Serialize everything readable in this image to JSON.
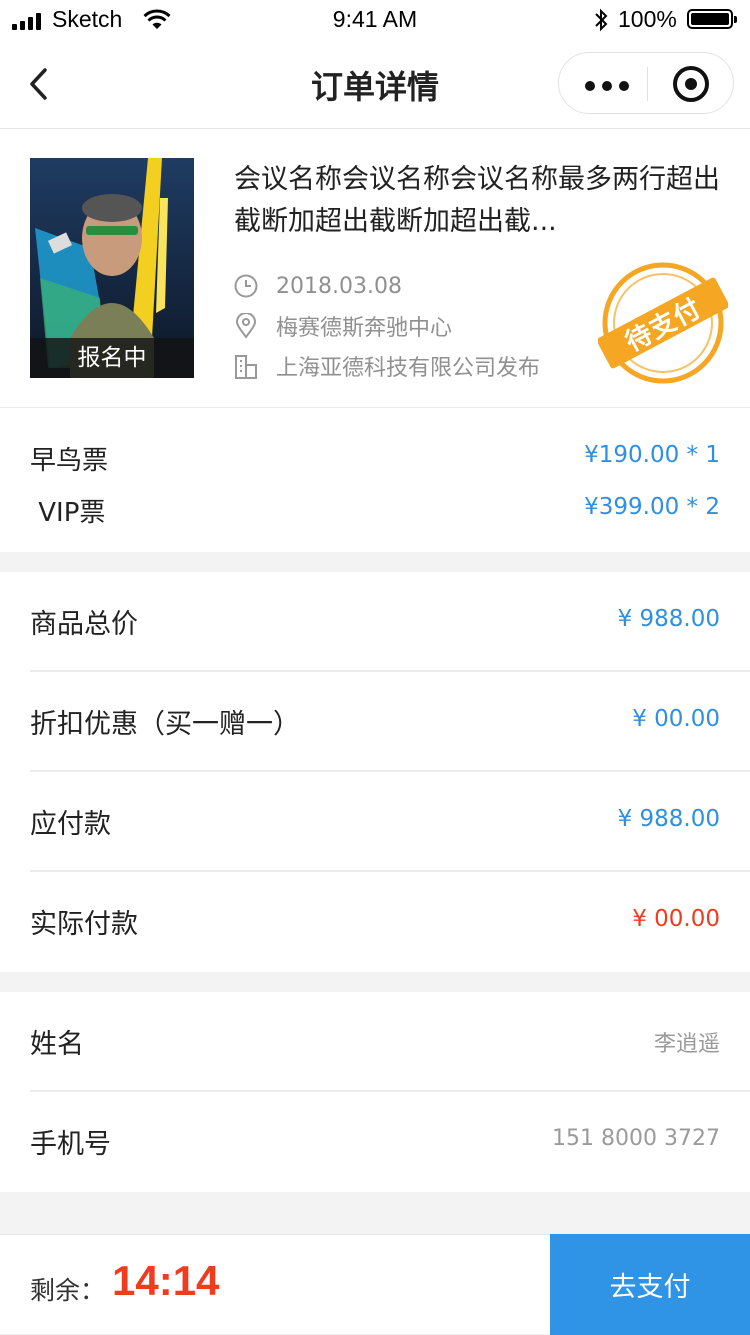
{
  "status_bar": {
    "carrier": "Sketch",
    "time": "9:41 AM",
    "battery": "100%"
  },
  "nav": {
    "title": "订单详情",
    "icons": [
      "back-chevron-icon",
      "more-dots-icon",
      "target-icon"
    ]
  },
  "event": {
    "poster_status": "报名中",
    "title": "会议名称会议名称会议名称最多两行超出截断加超出截断加超出截...",
    "date": "2018.03.08",
    "location": "梅赛德斯奔驰中心",
    "publisher": "上海亚德科技有限公司发布",
    "stamp": "待支付",
    "icons": [
      "clock-icon",
      "location-pin-icon",
      "building-icon"
    ]
  },
  "tickets": [
    {
      "name": "早鸟票",
      "price": "¥190.00 * 1"
    },
    {
      "name": " VIP票",
      "price": "¥399.00 * 2"
    }
  ],
  "summary": [
    {
      "label": "商品总价",
      "value": "¥ 988.00",
      "color": "#2f8fe0"
    },
    {
      "label": "折扣优惠（买一赠一）",
      "value": "¥ 00.00",
      "color": "#2f8fe0"
    },
    {
      "label": "应付款",
      "value": "¥ 988.00",
      "color": "#2f8fe0"
    },
    {
      "label": "实际付款",
      "value": "¥ 00.00",
      "color": "#f03c1e"
    }
  ],
  "contact": {
    "name_label": "姓名",
    "name_value": "李逍遥",
    "phone_label": "手机号",
    "phone_value": "151 8000 3727"
  },
  "footer": {
    "remain_label": "剩余：",
    "remain_time": "14:14",
    "pay_button": "去支付"
  },
  "colors": {
    "accent": "#2f93e6",
    "price_blue": "#2f8fe0",
    "alert_red": "#f03c1e",
    "stamp_orange": "#f5a623"
  }
}
